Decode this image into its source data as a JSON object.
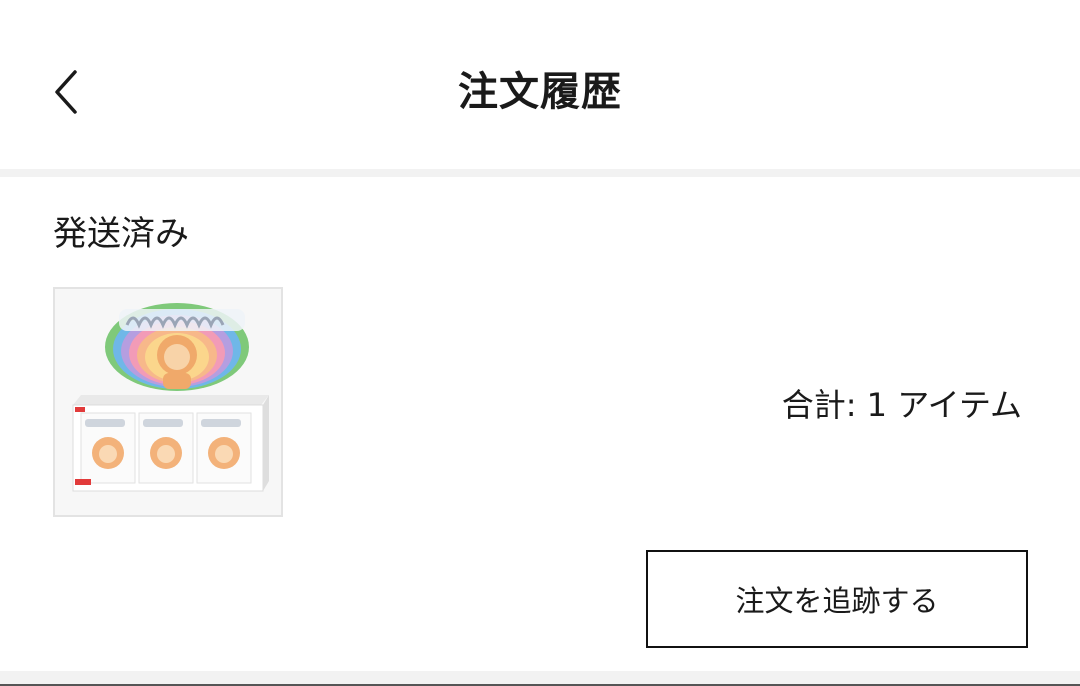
{
  "header": {
    "title": "注文履歴",
    "back_icon": "chevron-left-icon"
  },
  "order": {
    "status": "発送済み",
    "product_image_alt": "Big into Energy",
    "summary": "合計: 1 アイテム",
    "track_button_label": "注文を追跡する"
  },
  "colors": {
    "divider": "#f2f2f2",
    "button_border": "#111111",
    "text": "#1a1a1a"
  }
}
